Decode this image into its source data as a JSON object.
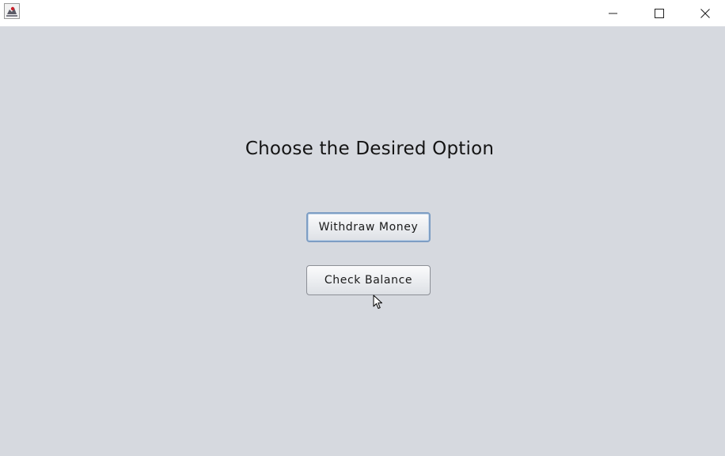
{
  "window": {
    "app_icon": "java-cup-icon",
    "controls": {
      "minimize": "minimize-icon",
      "maximize": "maximize-icon",
      "close": "close-icon"
    }
  },
  "main": {
    "heading": "Choose the Desired Option",
    "buttons": {
      "withdraw": "Withdraw Money",
      "balance": "Check Balance"
    }
  },
  "colors": {
    "background": "#d6d9df",
    "focus_ring": "#7e9ec4"
  }
}
